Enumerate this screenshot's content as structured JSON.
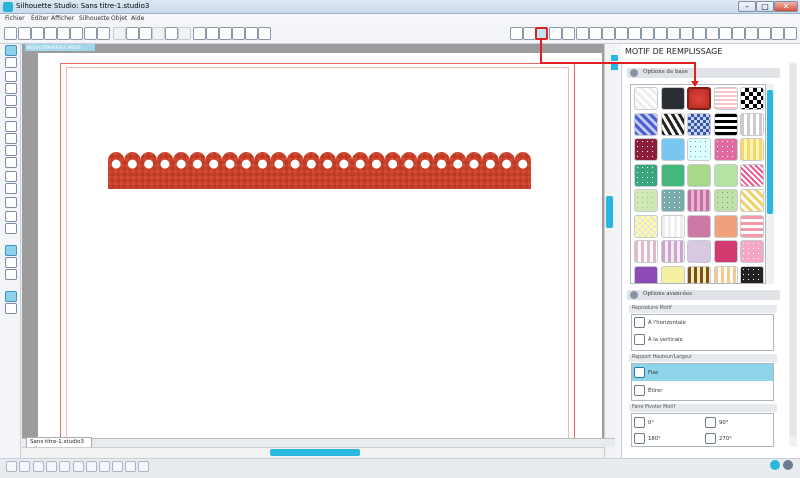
{
  "window": {
    "title": "Silhouette Studio: Sans titre-1.studio3"
  },
  "menu": [
    "Fichier",
    "Éditer",
    "Afficher",
    "Silhouette",
    "Objet",
    "Aide"
  ],
  "canvas": {
    "ruler_label": "MEDIA DÉMARRAGE MEDIA",
    "doc_tab": "Sans titre-1.studio3",
    "doc_tab_close": "x"
  },
  "panel": {
    "title": "MOTIF DE REMPLISSAGE",
    "basic_section": "Options de base",
    "advanced_section": "Options avancées",
    "repeat_label": "Reproduire Motif",
    "repeat_h": "À l'horizontale",
    "repeat_v": "À la verticale",
    "ratio_label": "Rapport Hauteur/Largeur",
    "fixed": "Fixe",
    "stretch": "Étirer",
    "rotate_label": "Faire Pivoter Motif",
    "rot0": "0°",
    "rot90": "90°",
    "rot180": "180°",
    "rot270": "270°"
  },
  "colors": {
    "accent": "#29b6df",
    "highlight": "#e02020",
    "shape": "#c8402a"
  }
}
